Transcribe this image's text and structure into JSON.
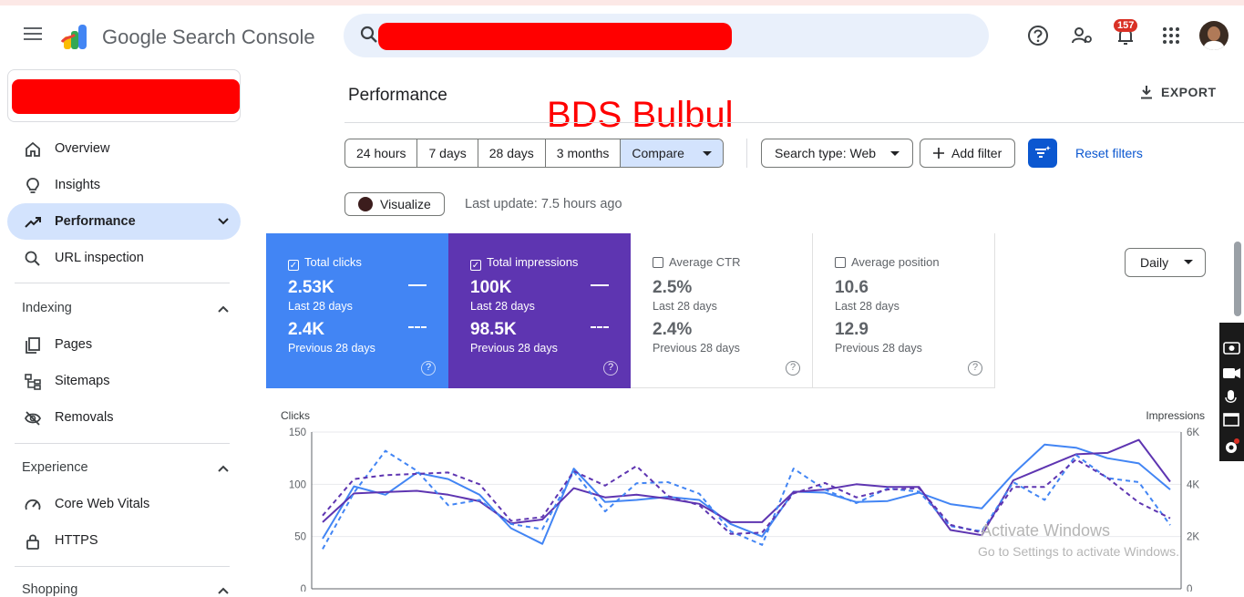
{
  "app": {
    "title": "Google Search Console"
  },
  "header": {
    "notification_count": "157"
  },
  "sidebar": {
    "items": [
      {
        "label": "Overview"
      },
      {
        "label": "Insights"
      },
      {
        "label": "Performance"
      },
      {
        "label": "URL inspection"
      }
    ],
    "indexing": {
      "title": "Indexing",
      "items": [
        {
          "label": "Pages"
        },
        {
          "label": "Sitemaps"
        },
        {
          "label": "Removals"
        }
      ]
    },
    "experience": {
      "title": "Experience",
      "items": [
        {
          "label": "Core Web Vitals"
        },
        {
          "label": "HTTPS"
        }
      ]
    },
    "shopping": {
      "title": "Shopping"
    }
  },
  "main": {
    "title": "Performance",
    "overlay_text": "BDS Bulbul",
    "export_label": "EXPORT",
    "ranges": [
      "24 hours",
      "7 days",
      "28 days",
      "3 months",
      "Compare"
    ],
    "search_type": "Search type: Web",
    "add_filter": "Add filter",
    "reset_filters": "Reset filters",
    "visualize": "Visualize",
    "last_update": "Last update: 7.5 hours ago",
    "granularity": "Daily"
  },
  "metrics": {
    "clicks": {
      "label": "Total clicks",
      "value": "2.53K",
      "period": "Last 28 days",
      "prev_value": "2.4K",
      "prev_period": "Previous 28 days"
    },
    "impressions": {
      "label": "Total impressions",
      "value": "100K",
      "period": "Last 28 days",
      "prev_value": "98.5K",
      "prev_period": "Previous 28 days"
    },
    "ctr": {
      "label": "Average CTR",
      "value": "2.5%",
      "period": "Last 28 days",
      "prev_value": "2.4%",
      "prev_period": "Previous 28 days"
    },
    "position": {
      "label": "Average position",
      "value": "10.6",
      "period": "Last 28 days",
      "prev_value": "12.9",
      "prev_period": "Previous 28 days"
    }
  },
  "watermark": {
    "line1": "Activate Windows",
    "line2": "Go to Settings to activate Windows."
  },
  "colors": {
    "clicks": "#4285f4",
    "impressions": "#5e35b1",
    "accent": "#0b57d0"
  },
  "chart_data": {
    "type": "line",
    "ylabel": "Clicks",
    "y2label": "Impressions",
    "ylim": [
      0,
      150
    ],
    "y2lim": [
      0,
      6000
    ],
    "yticks": [
      "0",
      "50",
      "100",
      "150"
    ],
    "y2ticks": [
      "0",
      "2K",
      "4K",
      "6K"
    ],
    "grid": true,
    "series": [
      {
        "name": "Total clicks",
        "axis": "left",
        "values": [
          48,
          98,
          90,
          111,
          105,
          90,
          58,
          43,
          115,
          83,
          85,
          88,
          85,
          62,
          50,
          93,
          92,
          83,
          84,
          92,
          81,
          77,
          110,
          138,
          135,
          125,
          120,
          95
        ]
      },
      {
        "name": "Total impressions",
        "axis": "right",
        "values": [
          2550,
          3650,
          3700,
          3750,
          3600,
          3350,
          2500,
          2650,
          3850,
          3500,
          3600,
          3450,
          3250,
          2550,
          2550,
          3700,
          3800,
          4000,
          3900,
          3900,
          2250,
          2050,
          4150,
          4650,
          5150,
          5200,
          5700,
          4100
        ]
      },
      {
        "name": "Total clicks (previous)",
        "axis": "left",
        "dashed": true,
        "values": [
          38,
          92,
          132,
          113,
          80,
          85,
          62,
          57,
          112,
          74,
          101,
          102,
          91,
          55,
          42,
          115,
          95,
          82,
          96,
          93,
          60,
          55,
          102,
          85,
          128,
          106,
          102,
          61
        ]
      },
      {
        "name": "Total impressions (previous)",
        "axis": "right",
        "dashed": true,
        "values": [
          2800,
          4200,
          4350,
          4400,
          4450,
          4000,
          2600,
          2750,
          4500,
          3950,
          4700,
          3550,
          3200,
          2100,
          2150,
          3650,
          4050,
          3500,
          3800,
          3850,
          2450,
          2150,
          3900,
          3900,
          4950,
          4250,
          3300,
          2700
        ]
      }
    ]
  }
}
